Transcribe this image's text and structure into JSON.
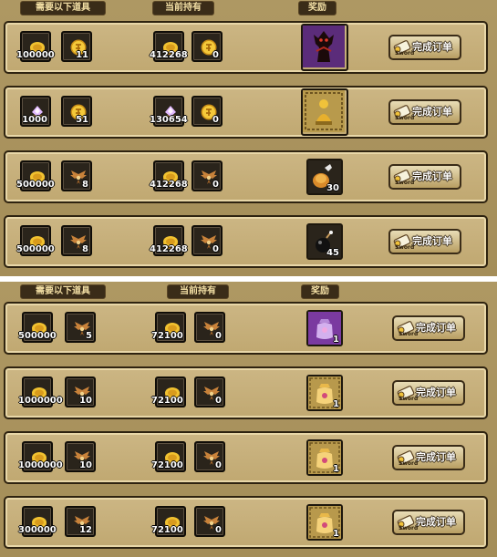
{
  "headers": {
    "required": "需要以下道具",
    "owned": "当前持有",
    "reward": "奖励"
  },
  "button": {
    "label": "完成订单",
    "sub": "Sword"
  },
  "colors": {
    "panel": "#a8915c",
    "row": "#c7b07a",
    "slot": "#2a241b",
    "header_bg": "#3a2c18",
    "header_text": "#f3dfa4"
  },
  "top_rows": [
    {
      "req": [
        {
          "icon": "gold-coin-icon",
          "count": "100000"
        },
        {
          "icon": "token-coin-icon",
          "count": "11"
        }
      ],
      "own": [
        {
          "icon": "gold-coin-icon",
          "count": "412268"
        },
        {
          "icon": "token-coin-icon",
          "count": "0"
        }
      ],
      "reward": {
        "icon": "demon-statue-icon",
        "count": ""
      }
    },
    {
      "req": [
        {
          "icon": "crystal-icon",
          "count": "1000"
        },
        {
          "icon": "token-coin-icon",
          "count": "51"
        }
      ],
      "own": [
        {
          "icon": "crystal-icon",
          "count": "130654"
        },
        {
          "icon": "token-coin-icon",
          "count": "0"
        }
      ],
      "reward": {
        "icon": "golden-idol-icon",
        "count": ""
      }
    },
    {
      "req": [
        {
          "icon": "gold-coin-icon",
          "count": "500000"
        },
        {
          "icon": "wing-emblem-icon",
          "count": "8"
        }
      ],
      "own": [
        {
          "icon": "gold-coin-icon",
          "count": "412268"
        },
        {
          "icon": "wing-emblem-icon",
          "count": "0"
        }
      ],
      "reward": {
        "icon": "pouch-icon",
        "count": "30"
      }
    },
    {
      "req": [
        {
          "icon": "gold-coin-icon",
          "count": "500000"
        },
        {
          "icon": "wing-emblem-icon",
          "count": "8"
        }
      ],
      "own": [
        {
          "icon": "gold-coin-icon",
          "count": "412268"
        },
        {
          "icon": "wing-emblem-icon",
          "count": "0"
        }
      ],
      "reward": {
        "icon": "bomb-icon",
        "count": "45"
      }
    }
  ],
  "bottom_rows": [
    {
      "req": [
        {
          "icon": "gold-coin-icon",
          "count": "500000"
        },
        {
          "icon": "wing-emblem-icon",
          "count": "5"
        }
      ],
      "own": [
        {
          "icon": "gold-coin-icon",
          "count": "72100"
        },
        {
          "icon": "wing-emblem-icon",
          "count": "0"
        }
      ],
      "reward": {
        "icon": "purple-bag-icon",
        "count": "1"
      }
    },
    {
      "req": [
        {
          "icon": "gold-coin-icon",
          "count": "1000000"
        },
        {
          "icon": "wing-emblem-icon",
          "count": "10"
        }
      ],
      "own": [
        {
          "icon": "gold-coin-icon",
          "count": "72100"
        },
        {
          "icon": "wing-emblem-icon",
          "count": "0"
        }
      ],
      "reward": {
        "icon": "gold-bag-icon",
        "count": "1"
      }
    },
    {
      "req": [
        {
          "icon": "gold-coin-icon",
          "count": "1000000"
        },
        {
          "icon": "wing-emblem-icon",
          "count": "10"
        }
      ],
      "own": [
        {
          "icon": "gold-coin-icon",
          "count": "72100"
        },
        {
          "icon": "wing-emblem-icon",
          "count": "0"
        }
      ],
      "reward": {
        "icon": "gold-bag-icon",
        "count": "1"
      }
    },
    {
      "req": [
        {
          "icon": "gold-coin-icon",
          "count": "300000"
        },
        {
          "icon": "wing-emblem-icon",
          "count": "12"
        }
      ],
      "own": [
        {
          "icon": "gold-coin-icon",
          "count": "72100"
        },
        {
          "icon": "wing-emblem-icon",
          "count": "0"
        }
      ],
      "reward": {
        "icon": "gold-bag-icon",
        "count": "1"
      }
    }
  ]
}
